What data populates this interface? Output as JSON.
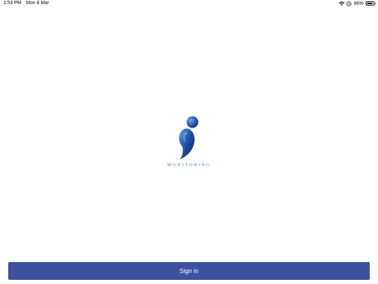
{
  "status_bar": {
    "time": "1:53 PM",
    "date": "Mon 8 Mar",
    "battery_percent": "86%",
    "battery_level": 0.86,
    "icons": [
      "wifi-icon",
      "location-icon",
      "battery-icon"
    ]
  },
  "logo": {
    "text": "MONITORING",
    "colors": {
      "head": "#1f4f9e",
      "body_dark": "#0e2a6b",
      "body_light": "#4f92d8",
      "text": "#3a7fc0"
    }
  },
  "signin": {
    "label": "Sign in",
    "color": "#3f51a1"
  }
}
